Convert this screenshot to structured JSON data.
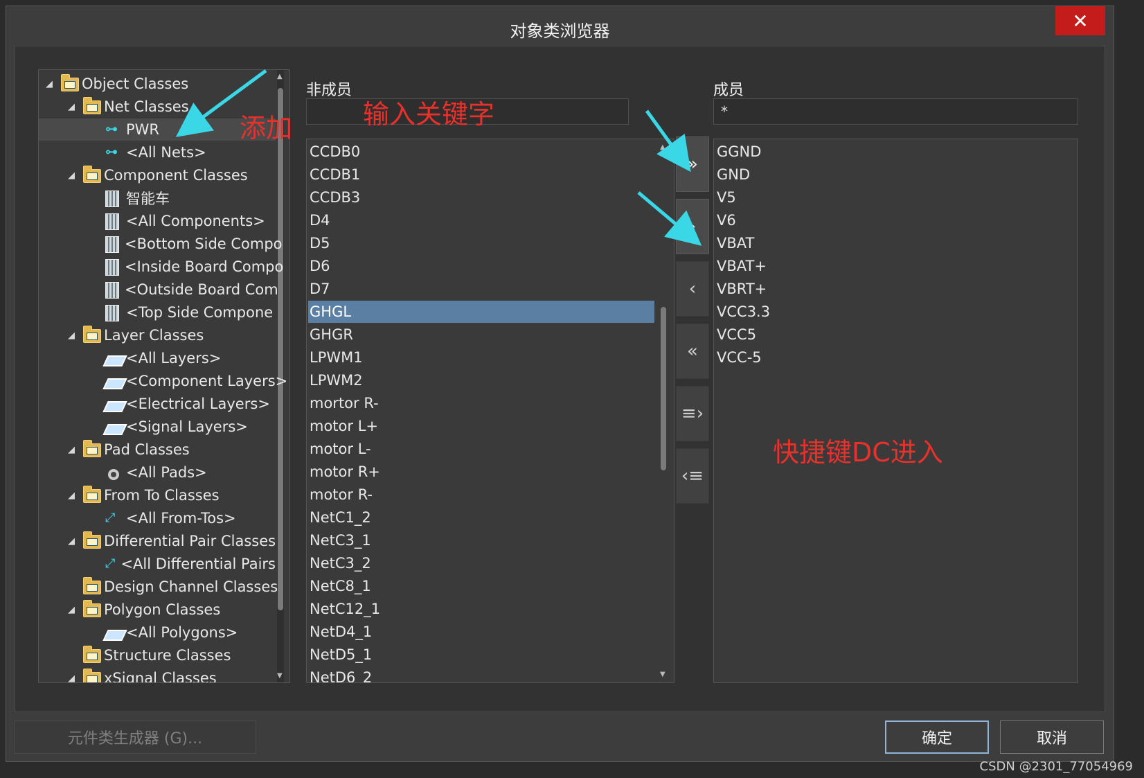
{
  "window": {
    "title": "对象类浏览器",
    "close_symbol": "✕"
  },
  "tree": {
    "items": [
      {
        "label": "Object Classes",
        "level": 0,
        "expanded": true,
        "icon": "folder-icon"
      },
      {
        "label": "Net Classes",
        "level": 1,
        "expanded": true,
        "icon": "folder-icon"
      },
      {
        "label": "PWR",
        "level": 2,
        "icon": "net-class-icon",
        "selected": true
      },
      {
        "label": "<All Nets>",
        "level": 2,
        "icon": "net-class-icon"
      },
      {
        "label": "Component Classes",
        "level": 1,
        "expanded": true,
        "icon": "folder-icon"
      },
      {
        "label": "智能车",
        "level": 2,
        "icon": "component-icon"
      },
      {
        "label": "<All Components>",
        "level": 2,
        "icon": "component-icon"
      },
      {
        "label": "<Bottom Side Compo",
        "level": 2,
        "icon": "component-icon"
      },
      {
        "label": "<Inside Board Compo",
        "level": 2,
        "icon": "component-icon"
      },
      {
        "label": "<Outside Board Com",
        "level": 2,
        "icon": "component-icon"
      },
      {
        "label": "<Top Side Compone",
        "level": 2,
        "icon": "component-icon"
      },
      {
        "label": "Layer Classes",
        "level": 1,
        "expanded": true,
        "icon": "folder-icon"
      },
      {
        "label": "<All Layers>",
        "level": 2,
        "icon": "layer-icon"
      },
      {
        "label": "<Component Layers>",
        "level": 2,
        "icon": "layer-icon"
      },
      {
        "label": "<Electrical Layers>",
        "level": 2,
        "icon": "layer-icon"
      },
      {
        "label": "<Signal Layers>",
        "level": 2,
        "icon": "layer-icon"
      },
      {
        "label": "Pad Classes",
        "level": 1,
        "expanded": true,
        "icon": "folder-icon"
      },
      {
        "label": "<All Pads>",
        "level": 2,
        "icon": "pad-icon"
      },
      {
        "label": "From To Classes",
        "level": 1,
        "expanded": true,
        "icon": "folder-icon"
      },
      {
        "label": "<All From-Tos>",
        "level": 2,
        "icon": "from-to-icon"
      },
      {
        "label": "Differential Pair Classes",
        "level": 1,
        "expanded": true,
        "icon": "folder-icon"
      },
      {
        "label": "<All Differential Pairs",
        "level": 2,
        "icon": "from-to-icon"
      },
      {
        "label": "Design Channel Classes",
        "level": 1,
        "icon": "folder-icon"
      },
      {
        "label": "Polygon Classes",
        "level": 1,
        "expanded": true,
        "icon": "folder-icon"
      },
      {
        "label": "<All Polygons>",
        "level": 2,
        "icon": "layer-icon"
      },
      {
        "label": "Structure Classes",
        "level": 1,
        "icon": "folder-icon"
      },
      {
        "label": "xSignal Classes",
        "level": 1,
        "expanded": true,
        "icon": "folder-icon"
      }
    ]
  },
  "non_members": {
    "label": "非成员",
    "search_value": "",
    "items": [
      "CCDB0",
      "CCDB1",
      "CCDB3",
      "D4",
      "D5",
      "D6",
      "D7",
      "GHGL",
      "GHGR",
      "LPWM1",
      "LPWM2",
      "mortor R-",
      "motor L+",
      "motor L-",
      "motor R+",
      "motor R-",
      "NetC1_2",
      "NetC3_1",
      "NetC3_2",
      "NetC8_1",
      "NetC12_1",
      "NetD4_1",
      "NetD5_1",
      "NetD6_2"
    ],
    "selected": "GHGL"
  },
  "members": {
    "label": "成员",
    "search_value": "*",
    "items": [
      "GGND",
      "GND",
      "V5",
      "V6",
      "VBAT",
      "VBAT+",
      "VBRT+",
      "VCC3.3",
      "VCC5",
      "VCC-5"
    ]
  },
  "transfer_buttons": [
    {
      "name": "add-all-button",
      "glyph": "»",
      "active": true
    },
    {
      "name": "add-selected-button",
      "glyph": "›",
      "active": true
    },
    {
      "name": "remove-selected-button",
      "glyph": "‹",
      "active": false
    },
    {
      "name": "remove-all-button",
      "glyph": "«",
      "active": false
    },
    {
      "name": "add-filtered-button",
      "glyph": "≡›",
      "active": false
    },
    {
      "name": "remove-filtered-button",
      "glyph": "‹≡",
      "active": false
    }
  ],
  "annotations": {
    "add": "添加",
    "keyword": "输入关键字",
    "shortcut": "快捷键DC进入"
  },
  "footer": {
    "generator_label": "元件类生成器 (G)...",
    "ok_label": "确定",
    "cancel_label": "取消"
  },
  "watermark": "CSDN @2301_77054969",
  "colors": {
    "accent_select": "#5b7fa3",
    "close_red": "#c41b1b",
    "annotation_red": "#e8312b",
    "arrow_cyan": "#3ad7e6"
  }
}
